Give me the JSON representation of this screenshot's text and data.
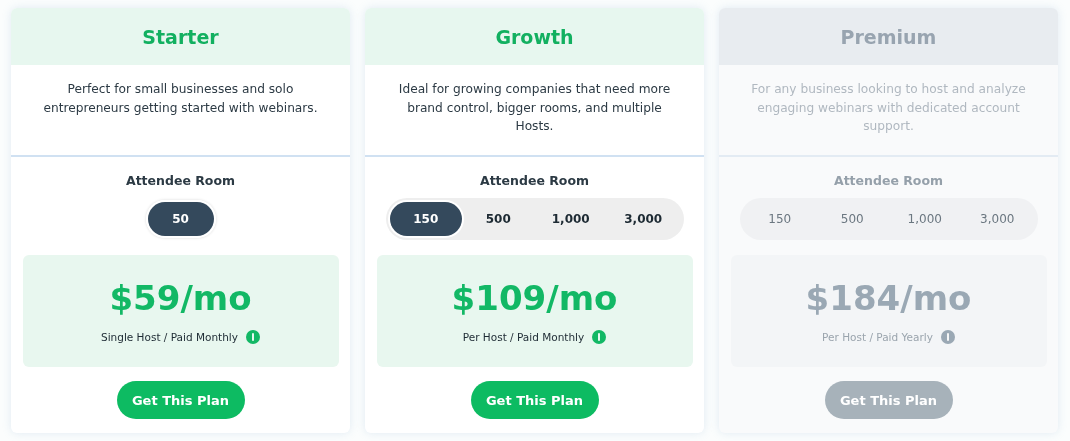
{
  "plans": [
    {
      "name": "Starter",
      "disabled": false,
      "description": "Perfect for small businesses and solo entrepreneurs getting started with webinars.",
      "room_label": "Attendee Room",
      "rooms": [
        {
          "label": "50",
          "selected": true
        }
      ],
      "price": "$59/mo",
      "billing": "Single Host / Paid Monthly",
      "button": "Get This Plan"
    },
    {
      "name": "Growth",
      "disabled": false,
      "description": "Ideal for growing companies that need more brand control, bigger rooms, and multiple Hosts.",
      "room_label": "Attendee Room",
      "rooms": [
        {
          "label": "150",
          "selected": true
        },
        {
          "label": "500",
          "selected": false
        },
        {
          "label": "1,000",
          "selected": false
        },
        {
          "label": "3,000",
          "selected": false
        }
      ],
      "price": "$109/mo",
      "billing": "Per Host / Paid Monthly",
      "button": "Get This Plan"
    },
    {
      "name": "Premium",
      "disabled": true,
      "description": "For any business looking to host and analyze engaging webinars with dedicated account support.",
      "room_label": "Attendee Room",
      "rooms": [
        {
          "label": "150",
          "selected": false
        },
        {
          "label": "500",
          "selected": false
        },
        {
          "label": "1,000",
          "selected": false
        },
        {
          "label": "3,000",
          "selected": false
        }
      ],
      "price": "$184/mo",
      "billing": "Per Host / Paid Yearly",
      "button": "Get This Plan"
    }
  ]
}
